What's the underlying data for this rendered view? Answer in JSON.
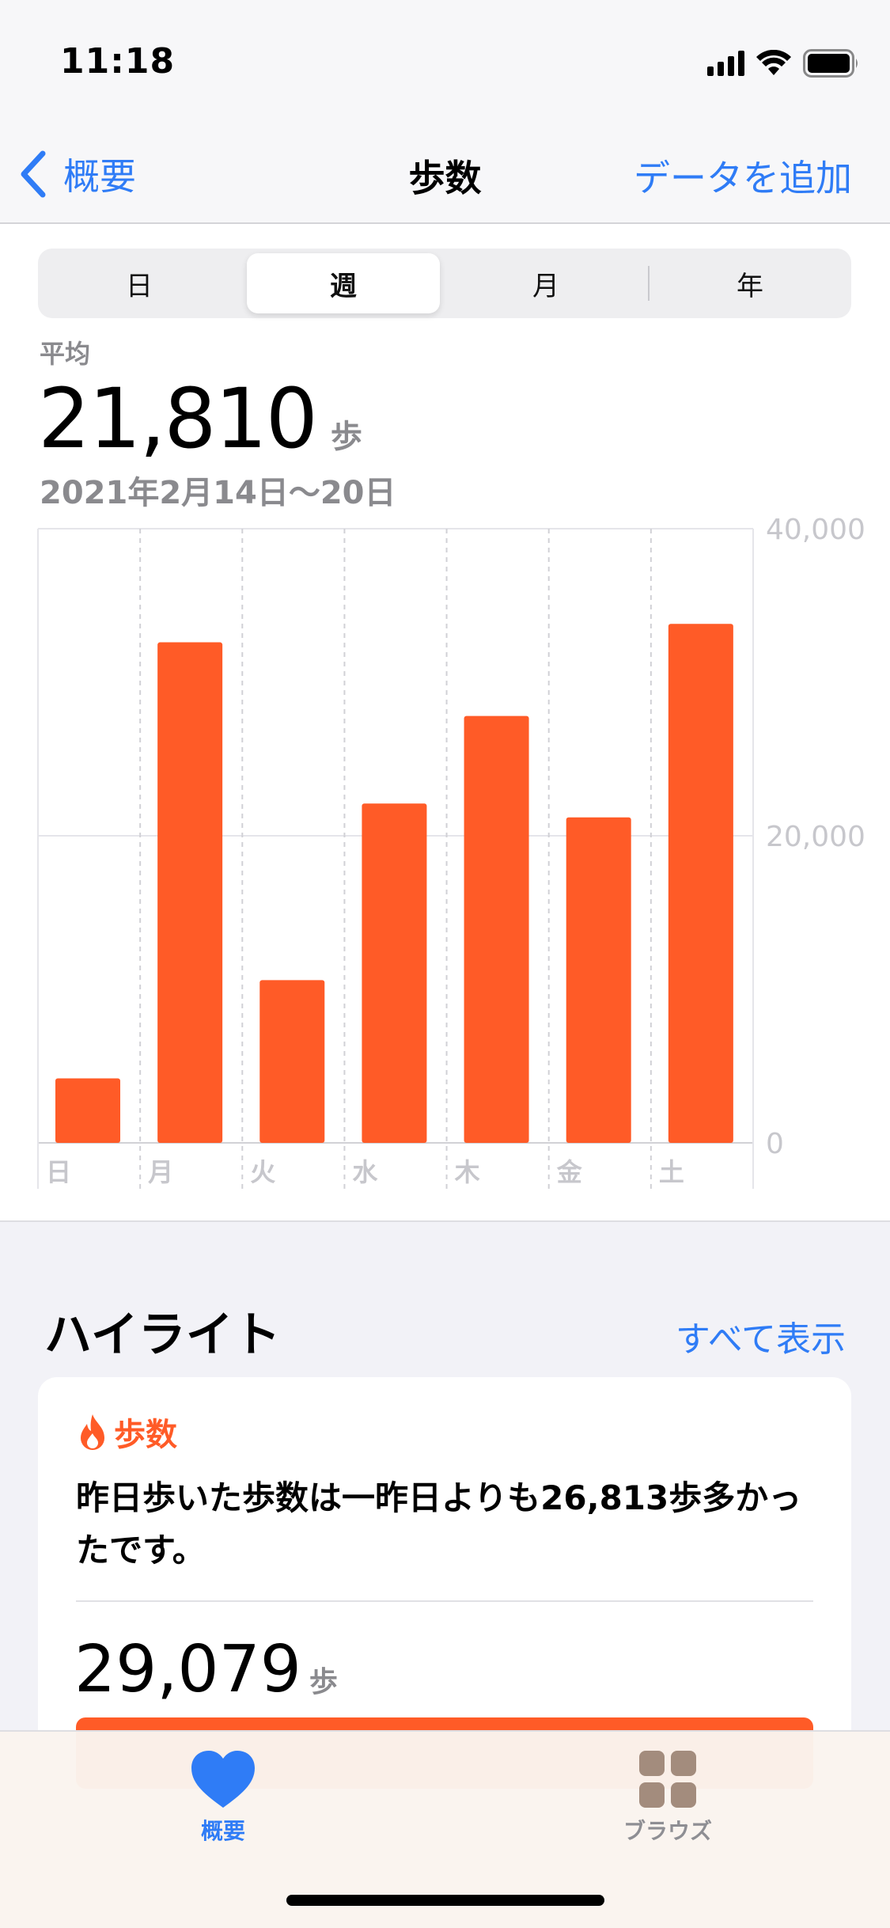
{
  "status_bar": {
    "time": "11:18"
  },
  "nav": {
    "back_label": "概要",
    "title": "歩数",
    "add_label": "データを追加"
  },
  "segments": [
    {
      "label": "日",
      "active": false
    },
    {
      "label": "週",
      "active": true
    },
    {
      "label": "月",
      "active": false
    },
    {
      "label": "年",
      "active": false
    }
  ],
  "summary": {
    "avg_label": "平均",
    "avg_value": "21,810",
    "avg_unit": "歩",
    "date_range": "2021年2月14日〜20日"
  },
  "chart_data": {
    "type": "bar",
    "categories": [
      "日",
      "月",
      "火",
      "水",
      "木",
      "金",
      "土"
    ],
    "values": [
      4200,
      32600,
      10600,
      22100,
      27800,
      21200,
      33800
    ],
    "ylim": [
      0,
      40000
    ],
    "y_ticks": [
      0,
      20000,
      40000
    ],
    "y_tick_labels": [
      "0",
      "20,000",
      "40,000"
    ],
    "color": "#ff5b27",
    "grid": true
  },
  "highlights": {
    "title": "ハイライト",
    "show_all": "すべて表示",
    "card": {
      "category": "歩数",
      "text": "昨日歩いた歩数は一昨日よりも26,813歩多かったです。",
      "value": "29,079",
      "unit": "歩"
    }
  },
  "tabs": [
    {
      "label": "概要",
      "icon": "heart-icon",
      "active": true
    },
    {
      "label": "ブラウズ",
      "icon": "grid-icon",
      "active": false
    }
  ],
  "colors": {
    "accent": "#2f7cf6",
    "steps": "#ff5b27",
    "inactive": "#8e8e93"
  }
}
